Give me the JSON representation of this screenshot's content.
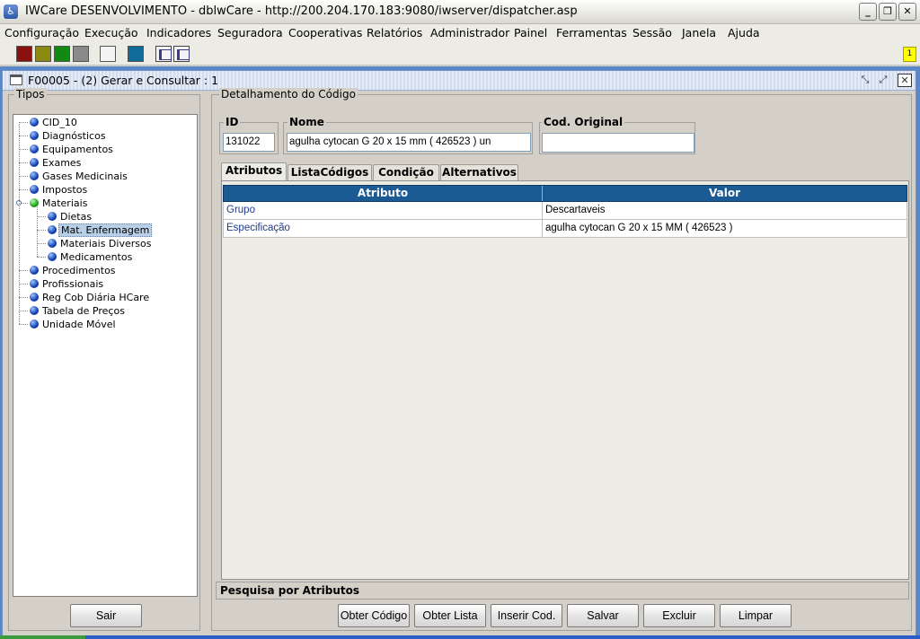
{
  "window": {
    "title": "IWCare DESENVOLVIMENTO - dblwCare - http://200.204.170.183:9080/iwserver/dispatcher.asp",
    "min_glyph": "_",
    "max_glyph": "❐",
    "close_glyph": "✕"
  },
  "menu": [
    "Configuração",
    "Execução",
    "Indicadores",
    "Seguradora",
    "Cooperativas",
    "Relatórios",
    "Administrador",
    "Painel",
    "Ferramentas",
    "Sessão",
    "Janela",
    "Ajuda"
  ],
  "toolbar": {
    "swatches": [
      "#8b1010",
      "#8a8a10",
      "#108a10",
      "#8a8a8a",
      "#f4f4f4",
      "#106a9a"
    ],
    "icons": [
      "tree-view-icon",
      "windows-icon"
    ],
    "badge": "1"
  },
  "frame": {
    "title": "F00005 - (2) Gerar e Consultar : 1",
    "icons": [
      "restore-icon",
      "maximize-icon",
      "close-icon"
    ]
  },
  "left": {
    "group_label": "Tipos",
    "tree": [
      {
        "label": "CID_10",
        "level": 0
      },
      {
        "label": "Diagnósticos",
        "level": 0
      },
      {
        "label": "Equipamentos",
        "level": 0
      },
      {
        "label": "Exames",
        "level": 0
      },
      {
        "label": "Gases Medicinais",
        "level": 0
      },
      {
        "label": "Impostos",
        "level": 0
      },
      {
        "label": "Materiais",
        "level": 0,
        "expanded": true,
        "color": "green"
      },
      {
        "label": "Dietas",
        "level": 1
      },
      {
        "label": "Mat. Enfermagem",
        "level": 1,
        "selected": true
      },
      {
        "label": "Materiais Diversos",
        "level": 1
      },
      {
        "label": "Medicamentos",
        "level": 1
      },
      {
        "label": "Procedimentos",
        "level": 0
      },
      {
        "label": "Profissionais",
        "level": 0
      },
      {
        "label": "Reg Cob Diária HCare",
        "level": 0
      },
      {
        "label": "Tabela de Preços",
        "level": 0
      },
      {
        "label": "Unidade Móvel",
        "level": 0
      }
    ],
    "exit_button": "Sair"
  },
  "right": {
    "group_label": "Detalhamento do Código",
    "id_label": "ID",
    "id_value": "131022",
    "nome_label": "Nome",
    "nome_value": "agulha cytocan  G 20 x 15 mm ( 426523 ) un",
    "cod_label": "Cod. Original",
    "cod_value": "",
    "tabs": [
      "Atributos",
      "ListaCódigos",
      "Condição",
      "Alternativos"
    ],
    "active_tab": "Atributos",
    "table": {
      "columns": [
        "Atributo",
        "Valor"
      ],
      "rows": [
        [
          "Grupo",
          "Descartaveis"
        ],
        [
          "Especificação",
          "agulha cytocan  G 20 x 15 MM ( 426523 )"
        ]
      ]
    },
    "search_label": "Pesquisa por Atributos",
    "buttons": [
      "Obter Código",
      "Obter Lista",
      "Inserir Cod.",
      "Salvar",
      "Excluir",
      "Limpar"
    ]
  }
}
